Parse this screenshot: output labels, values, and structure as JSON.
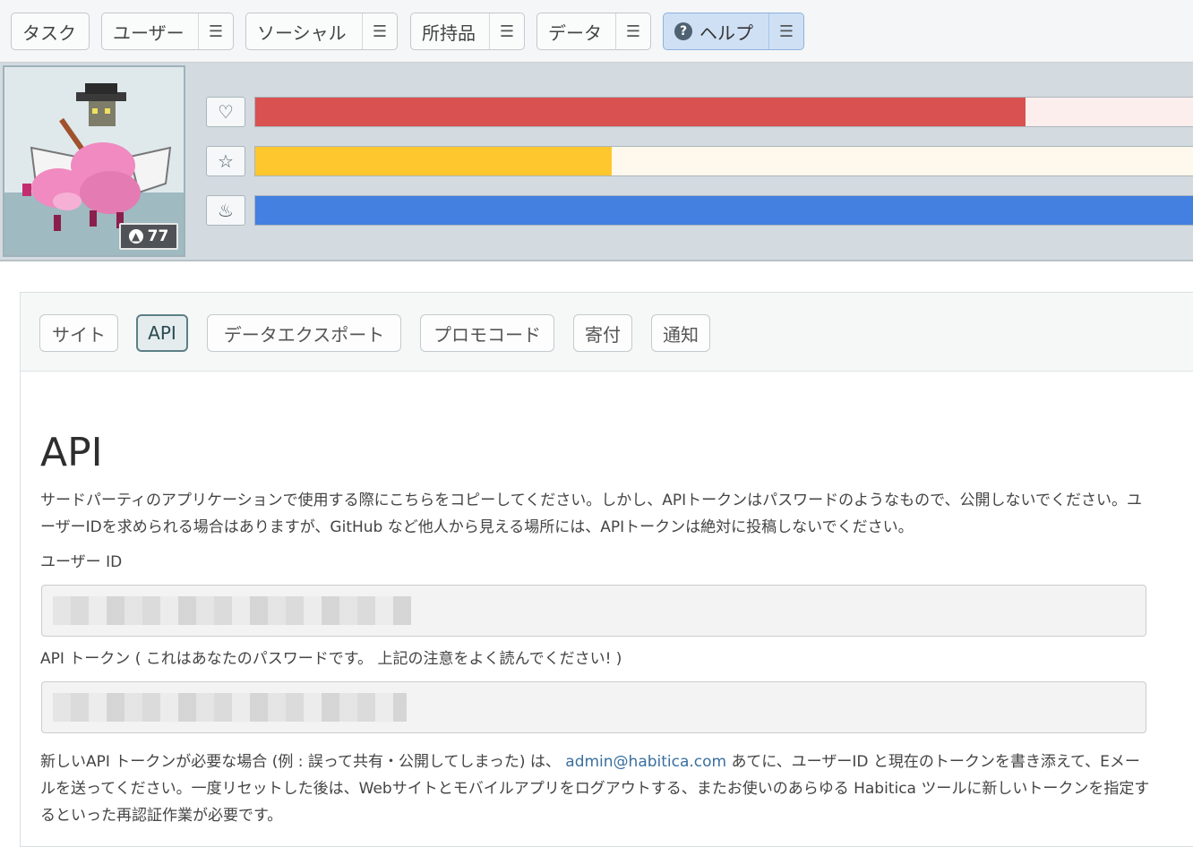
{
  "nav": {
    "tasks": "タスク",
    "user": "ユーザー",
    "social": "ソーシャル",
    "inventory": "所持品",
    "data": "データ",
    "help": "ヘルプ",
    "menu_glyph": "☰",
    "help_icon_glyph": "?"
  },
  "header": {
    "level": "77",
    "stats": {
      "health": {
        "icon": "heart-icon",
        "glyph": "♡",
        "fill": 0.8125,
        "color": "#d95151",
        "track": "#fdeeee"
      },
      "experience": {
        "icon": "star-icon",
        "glyph": "☆",
        "fill": 0.376,
        "color": "#ffc72e",
        "track": "#fff8ec"
      },
      "mana": {
        "icon": "flame-icon",
        "glyph": "♨",
        "fill": 1.0,
        "color": "#4380e0",
        "track": "#e8f0fb"
      }
    }
  },
  "tabs": [
    {
      "label": "サイト"
    },
    {
      "label": "API"
    },
    {
      "label": "データエクスポート"
    },
    {
      "label": "プロモコード"
    },
    {
      "label": "寄付"
    },
    {
      "label": "通知"
    }
  ],
  "api": {
    "title": "API",
    "intro": "サードパーティのアプリケーションで使用する際にこちらをコピーしてください。しかし、APIトークンはパスワードのようなもので、公開しないでください。ユーザーIDを求められる場合はありますが、GitHub など他人から見える場所には、APIトークンは絶対に投稿しないでください。",
    "user_id_label": "ユーザー ID",
    "user_id_value": "",
    "token_label": "API トークン ( これはあなたのパスワードです。 上記の注意をよく読んでください! )",
    "token_value": "",
    "reset_text_before": "新しいAPI トークンが必要な場合 (例 : 誤って共有・公開してしまった) は、",
    "reset_email": "admin@habitica.com",
    "reset_text_after": "あてに、ユーザーID と現在のトークンを書き添えて、Eメールを送ってください。一度リセットした後は、Webサイトとモバイルアプリをログアウトする、またお使いのあらゆる Habitica ツールに新しいトークンを指定するといった再認証作業が必要です。"
  }
}
